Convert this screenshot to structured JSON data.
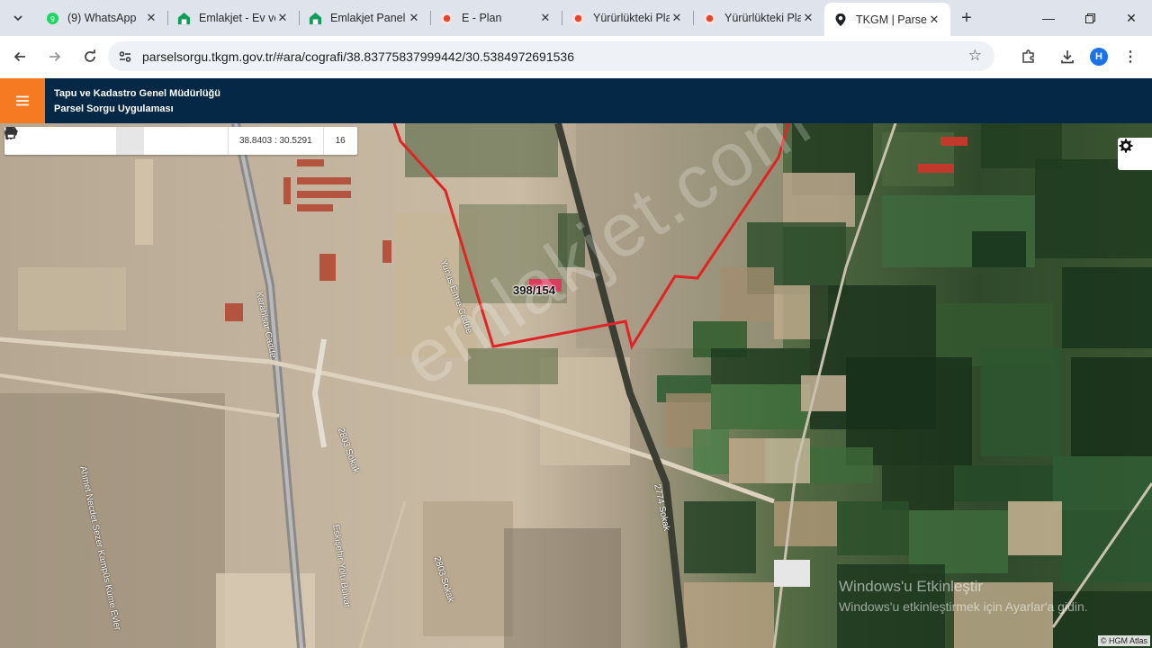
{
  "browser": {
    "tabs": [
      {
        "title": "(9) WhatsApp",
        "icon": "whatsapp-icon",
        "active": false
      },
      {
        "title": "Emlakjet - Ev ve Konut",
        "icon": "emlakjet-icon",
        "active": false
      },
      {
        "title": "Emlakjet Panel",
        "icon": "emlakjet-icon",
        "active": false
      },
      {
        "title": "E - Plan",
        "icon": "eplan-icon",
        "active": false
      },
      {
        "title": "Yürürlükteki Planlar",
        "icon": "eplan-icon",
        "active": false
      },
      {
        "title": "Yürürlükteki Planlar",
        "icon": "eplan-icon",
        "active": false
      },
      {
        "title": "TKGM | Parsel Sorgu",
        "icon": "location-pin-icon",
        "active": true
      }
    ],
    "url": "parselsorgu.tkgm.gov.tr/#ara/cografi/38.83775837999442/30.5384972691536",
    "profile_initial": "H"
  },
  "app": {
    "title_line1": "Tapu ve Kadastro Genel Müdürlüğü",
    "title_line2": "Parsel Sorgu Uygulaması"
  },
  "map": {
    "coordinates": "38.8403 : 30.5291",
    "zoom": "16",
    "parcel_label": "398/154",
    "streets": [
      {
        "name": "Yunus Emre Cadde"
      },
      {
        "name": "Karahisar Cadde"
      },
      {
        "name": "2803 Sokak"
      },
      {
        "name": "2774 Sokak"
      },
      {
        "name": "Ahmet Necdet Sezer Kampüs Küme Evler"
      },
      {
        "name": "Eskişehir Yolu Bulvar"
      },
      {
        "name": "2803 Sokak"
      }
    ],
    "watermark": "emlakjet.com",
    "attribution": "© HGM Atlas",
    "boundary_color": "#e02424"
  },
  "os": {
    "activate_line1": "Windows'u Etkinleştir",
    "activate_line2": "Windows'u etkinleştirmek için Ayarlar'a gidin."
  }
}
